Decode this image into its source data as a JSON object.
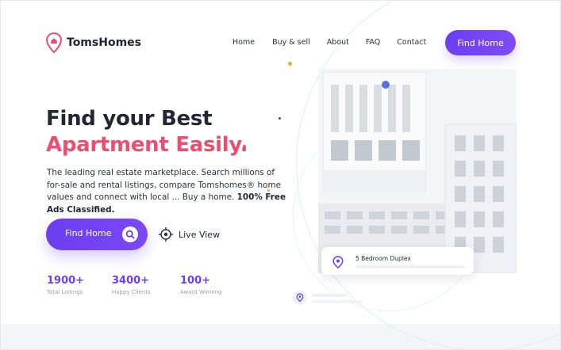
{
  "brand": {
    "name": "TomsHomes",
    "accent": "#6a3ff0",
    "pink": "#ea4f72"
  },
  "nav": {
    "items": [
      {
        "label": "Home"
      },
      {
        "label": "Buy & sell"
      },
      {
        "label": "About"
      },
      {
        "label": "FAQ"
      },
      {
        "label": "Contact"
      }
    ],
    "cta_label": "Find Home"
  },
  "hero": {
    "title_line1": "Find your Best",
    "title_line2": "Apartment Easily.",
    "description": "The leading real estate marketplace. Search millions of for-sale and rental listings, compare Tomshomes® home values and connect with local ... Buy a home.",
    "description_bold": "100% Free Ads Classified.",
    "primary_button": "Find Home",
    "secondary_button": "Live View"
  },
  "stats": [
    {
      "value": "1900+",
      "label": "Total Listings"
    },
    {
      "value": "3400+",
      "label": "Happy Clients"
    },
    {
      "value": "100+",
      "label": "Award Winning"
    }
  ],
  "listing_card": {
    "title": "5 Bedroom Duplex"
  },
  "icons": {
    "logo": "home-pin-icon",
    "search": "search-icon",
    "live_view": "target-icon",
    "location": "location-pin-icon"
  }
}
